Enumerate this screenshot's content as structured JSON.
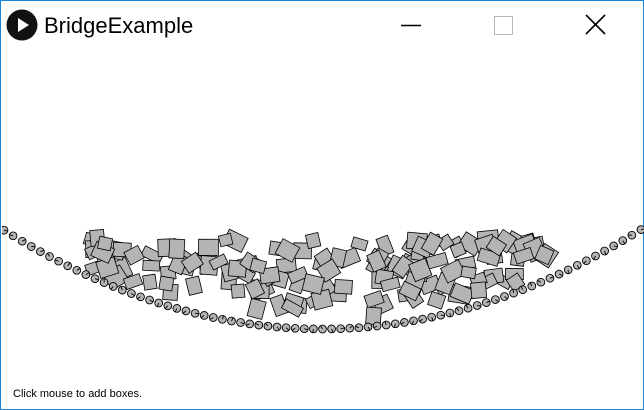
{
  "window": {
    "title": "BridgeExample",
    "controls": {
      "minimize": "minimize-icon",
      "maximize": "maximize-icon",
      "close": "close-icon"
    },
    "border_color": "#1883d7"
  },
  "sketch": {
    "instruction": "Click mouse to add boxes.",
    "background": "#ffffff",
    "box_fill": "#b4b4b4",
    "stroke": "#000000"
  }
}
